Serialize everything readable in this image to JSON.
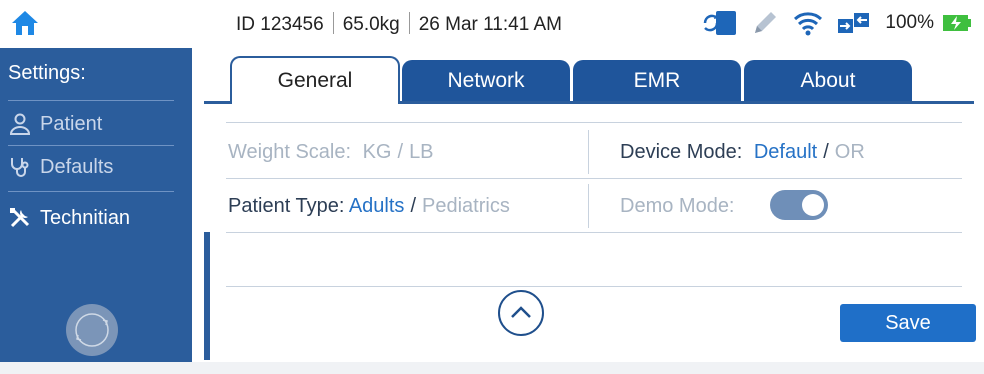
{
  "status": {
    "patient_id": "ID 123456",
    "weight": "65.0kg",
    "datetime": "26 Mar 11:41 AM",
    "battery_pct": "100%"
  },
  "sidebar": {
    "title": "Settings:",
    "items": [
      {
        "label": "Patient",
        "icon": "person-icon"
      },
      {
        "label": "Defaults",
        "icon": "stethoscope-icon"
      },
      {
        "label": "Technitian",
        "icon": "tools-icon",
        "active": true
      }
    ]
  },
  "tabs": [
    {
      "label": "General",
      "active": true
    },
    {
      "label": "Network"
    },
    {
      "label": "EMR"
    },
    {
      "label": "About"
    }
  ],
  "general": {
    "weight_scale": {
      "label": "Weight Scale:",
      "opt1": "KG",
      "sep": "/",
      "opt2": "LB"
    },
    "device_mode": {
      "label": "Device Mode:",
      "opt1": "Default",
      "sep": "/",
      "opt2": "OR"
    },
    "patient_type": {
      "label": "Patient Type:",
      "opt1": "Adults",
      "sep": "/",
      "opt2": "Pediatrics"
    },
    "demo_mode": {
      "label": "Demo Mode:",
      "enabled": true
    }
  },
  "actions": {
    "save_label": "Save"
  },
  "colors": {
    "accent": "#2b5d9c",
    "tab": "#1f559b",
    "save": "#1f6fc8",
    "link": "#2672c6"
  }
}
